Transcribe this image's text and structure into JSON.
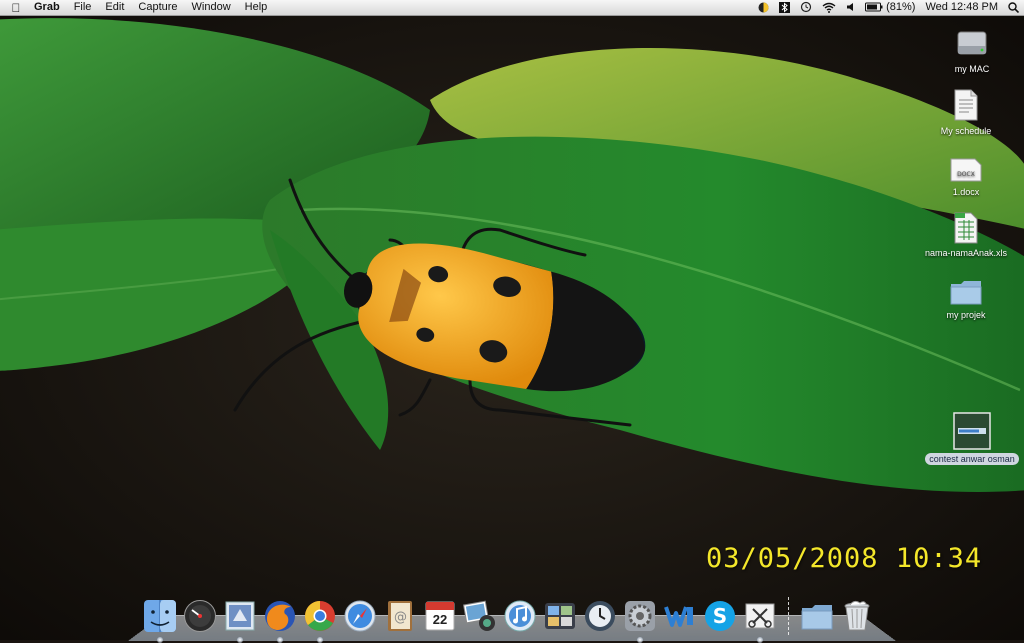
{
  "menubar": {
    "app_name": "Grab",
    "menus": [
      "File",
      "Edit",
      "Capture",
      "Window",
      "Help"
    ],
    "battery": "(81%)",
    "clock": "Wed 12:48 PM",
    "status_icons": [
      "do-not-disturb-icon",
      "bluetooth-icon",
      "time-machine-icon",
      "wifi-icon",
      "volume-icon",
      "battery-icon",
      "spotlight-icon"
    ]
  },
  "wallpaper": {
    "date_stamp": "03/05/2008 10:34"
  },
  "desktop_icons": [
    {
      "label": "my MAC",
      "icon": "hard-drive-icon"
    },
    {
      "label": "My schedule",
      "icon": "document-icon"
    },
    {
      "label": "1.docx",
      "icon": "docx-icon"
    },
    {
      "label": "nama-namaAnak.xls",
      "icon": "spreadsheet-icon"
    },
    {
      "label": "my projek",
      "icon": "folder-icon"
    },
    {
      "label": "contest anwar osman",
      "icon": "image-file-icon",
      "selected": true
    }
  ],
  "dock": {
    "apps": [
      "finder-icon",
      "dashboard-icon",
      "mail-icon",
      "firefox-icon",
      "chrome-icon",
      "safari-icon",
      "address-book-icon",
      "ical-icon",
      "iphoto-icon",
      "itunes-icon",
      "spaces-icon",
      "time-machine-icon",
      "system-preferences-icon",
      "word-icon",
      "skype-icon",
      "grab-icon"
    ],
    "ical_day": "22",
    "others": [
      "documents-folder-icon",
      "trash-icon"
    ]
  }
}
